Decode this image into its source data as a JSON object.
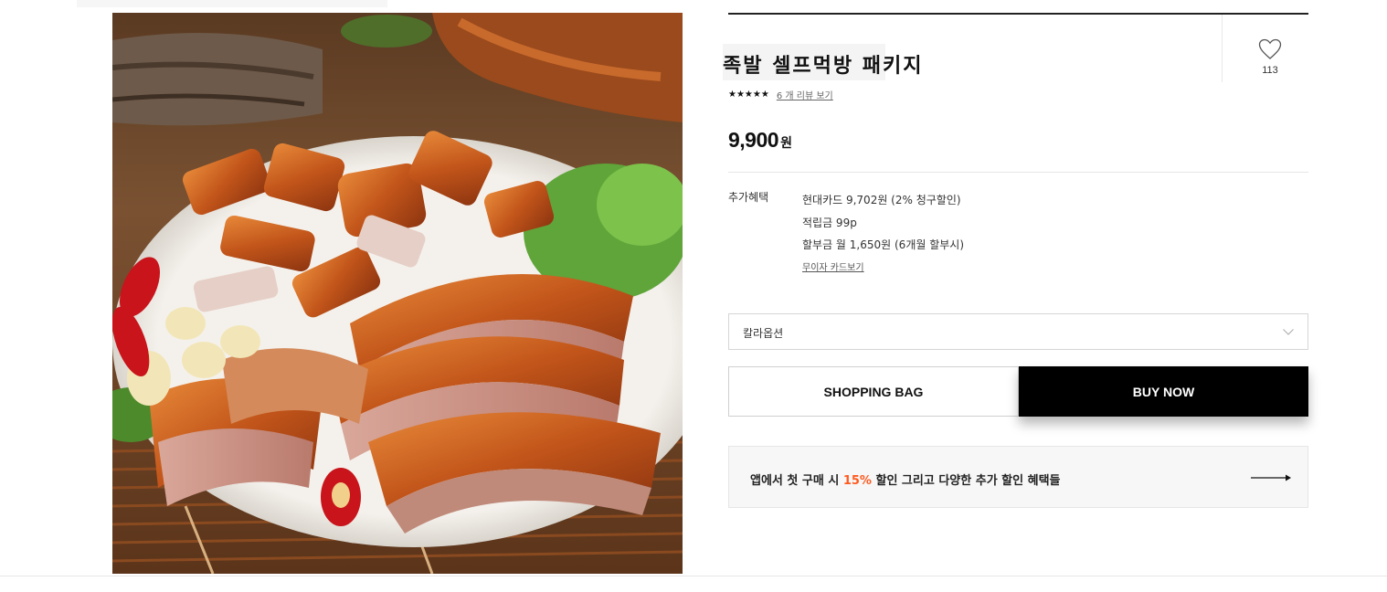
{
  "product": {
    "title": "족발 셀프먹방 패키지",
    "stars": "★★★★★",
    "rating": 5,
    "review_link": "6 개 리뷰 보기",
    "price": "9,900",
    "price_unit": "원"
  },
  "wishlist": {
    "icon": "heart-outline-icon",
    "count": "113"
  },
  "benefits": {
    "label": "추가혜택",
    "lines": [
      "현대카드 9,702원 (2% 청구할인)",
      "적립금 99p",
      "할부금 월 1,650원 (6개월 할부시)"
    ],
    "card_link": "무이자 카드보기"
  },
  "option": {
    "label": "칼라옵션",
    "icon": "chevron-down-icon"
  },
  "buttons": {
    "shopping_bag": "SHOPPING BAG",
    "buy_now": "BUY NOW"
  },
  "promo": {
    "text_before": "앱에서 첫 구매 시 ",
    "highlight": "15%",
    "text_after": " 할인 그리고 다양한 추가 할인 혜택들",
    "icon": "arrow-right-icon",
    "highlight_color": "#ff5a1f"
  },
  "colors": {
    "buy_button": "#000000",
    "accent": "#ff5a1f"
  }
}
